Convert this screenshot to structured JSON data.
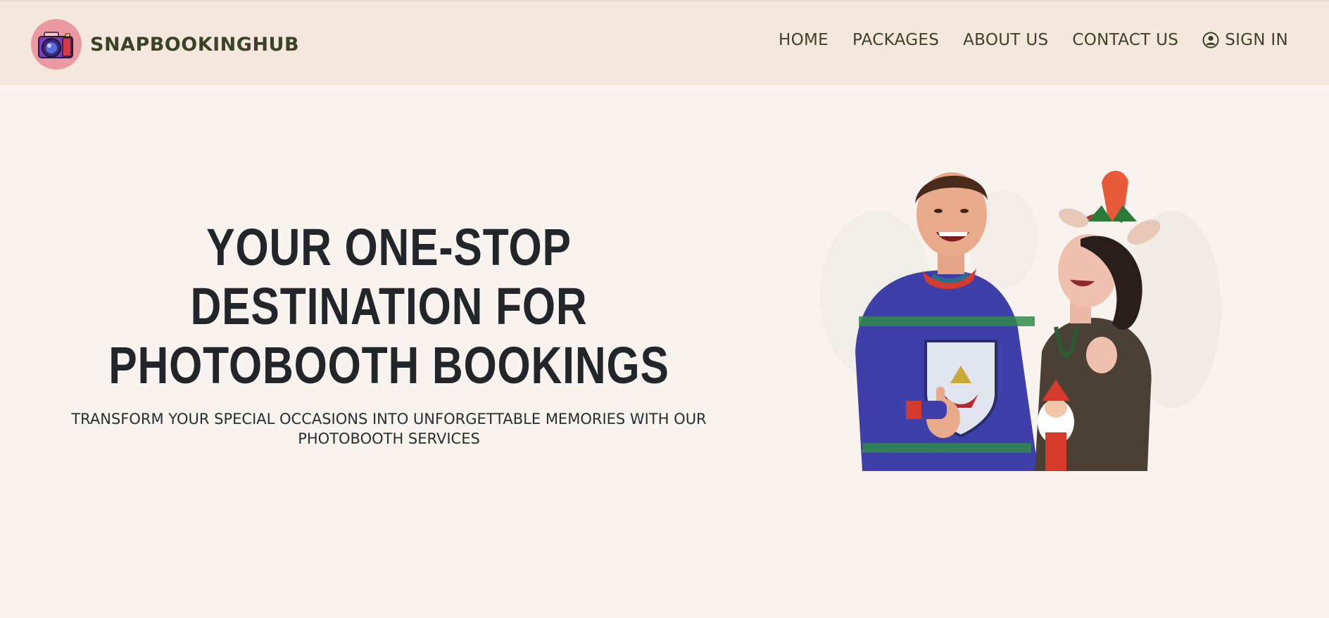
{
  "brand": {
    "name": "SNAPBOOKINGHUB",
    "logo_icon": "camera-icon",
    "logo_bg": "#ec9aa2"
  },
  "nav": {
    "items": [
      {
        "label": "HOME"
      },
      {
        "label": "PACKAGES"
      },
      {
        "label": "ABOUT US"
      },
      {
        "label": "CONTACT US"
      }
    ],
    "signin": {
      "label": "SIGN IN",
      "icon": "user-circle-icon"
    }
  },
  "hero": {
    "title_line1": "YOUR ONE-STOP DESTINATION FOR",
    "title_line2": "PHOTOBOOTH BOOKINGS",
    "subtitle": "TRANSFORM YOUR SPECIAL OCCASIONS INTO UNFORGETTABLE MEMORIES WITH OUR PHOTOBOOTH SERVICES"
  },
  "colors": {
    "page_bg": "#f8f3ef",
    "header_bg": "#f3e7de",
    "nav_text": "#3d4228",
    "title_text": "#22252a"
  }
}
